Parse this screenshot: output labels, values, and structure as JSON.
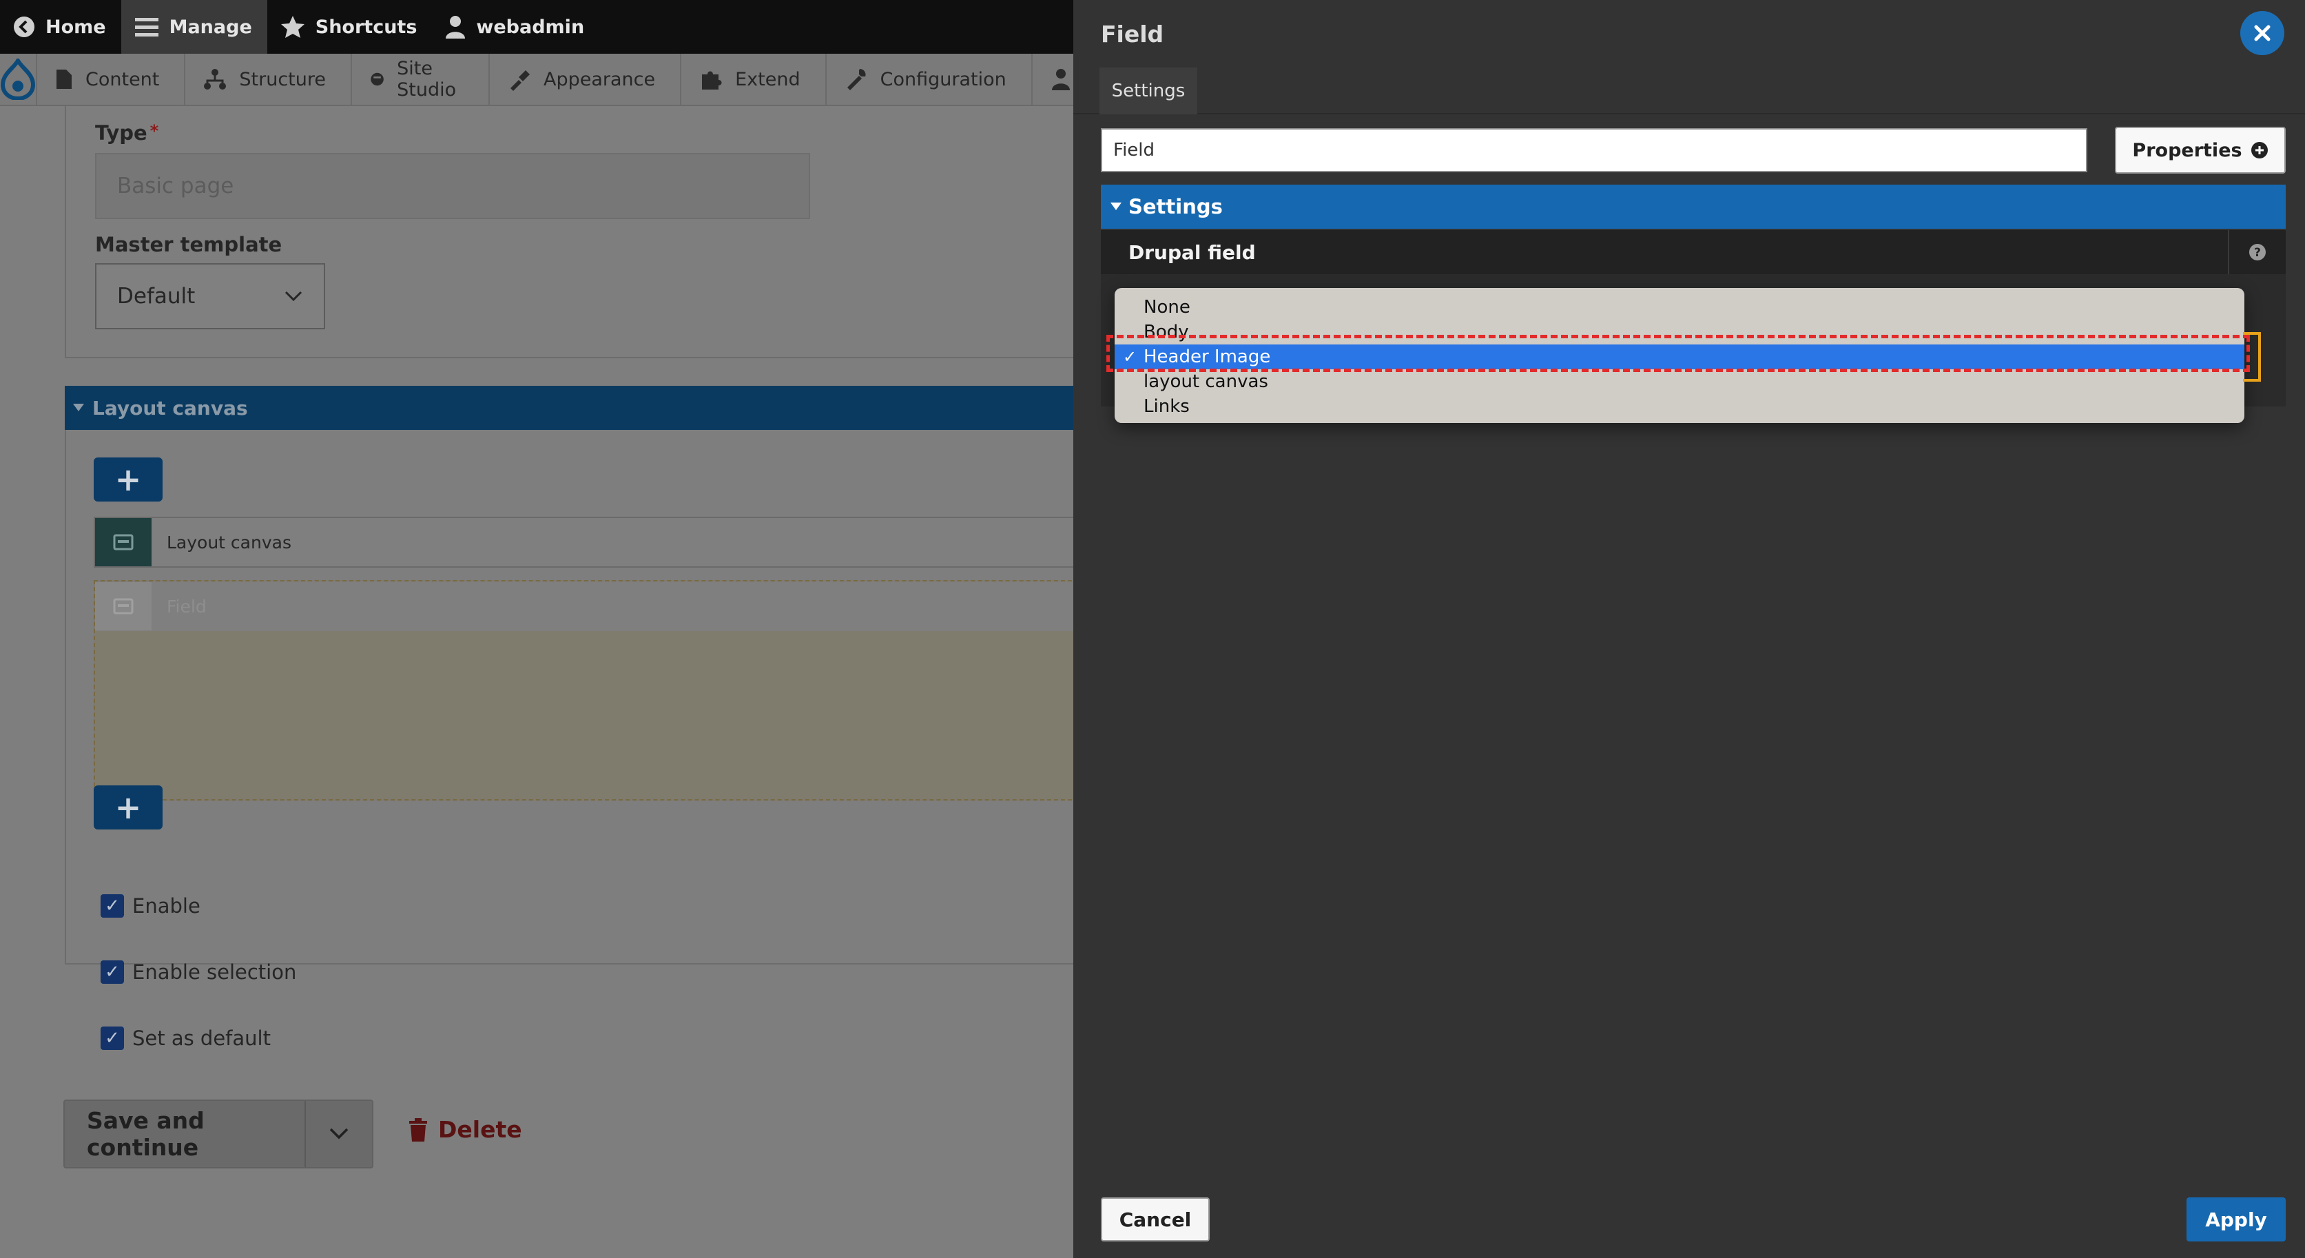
{
  "toolbar": {
    "items": [
      {
        "label": "Home",
        "icon": "home-chevron-icon"
      },
      {
        "label": "Manage",
        "icon": "hamburger-menu-icon"
      },
      {
        "label": "Shortcuts",
        "icon": "star-icon"
      },
      {
        "label": "webadmin",
        "icon": "user-icon"
      }
    ]
  },
  "tray": {
    "items": [
      {
        "label": "Content",
        "icon": "document-icon"
      },
      {
        "label": "Structure",
        "icon": "sitemap-icon"
      },
      {
        "label": "Site Studio",
        "icon": "site-studio-icon"
      },
      {
        "label": "Appearance",
        "icon": "paintbrush-icon"
      },
      {
        "label": "Extend",
        "icon": "puzzle-icon"
      },
      {
        "label": "Configuration",
        "icon": "wrench-icon"
      }
    ]
  },
  "form": {
    "type_label": "Type",
    "type_required": "*",
    "type_value": "Basic page",
    "master_template_label": "Master template",
    "master_template_value": "Default"
  },
  "layout_canvas": {
    "header": "Layout canvas",
    "add_label": "+",
    "row_label": "Layout canvas",
    "placeholder_label": "Field"
  },
  "checkboxes": [
    {
      "label": "Enable",
      "checked": true
    },
    {
      "label": "Enable selection",
      "checked": true
    },
    {
      "label": "Set as default",
      "checked": true
    }
  ],
  "actions": {
    "save_label": "Save and continue",
    "delete_label": "Delete"
  },
  "panel": {
    "title": "Field",
    "tab": "Settings",
    "title_input_value": "Field",
    "properties_label": "Properties",
    "settings_header": "Settings",
    "drupal_field_label": "Drupal field",
    "dropdown": {
      "options": [
        "None",
        "Body",
        "Header Image",
        "layout canvas",
        "Links"
      ],
      "selected": "Header Image"
    },
    "cancel_label": "Cancel",
    "apply_label": "Apply"
  },
  "colors": {
    "accent_blue": "#1669b0",
    "selection_blue": "#2a76e6",
    "delete_red": "#c42b2b",
    "highlight_red": "#e32b2b"
  }
}
